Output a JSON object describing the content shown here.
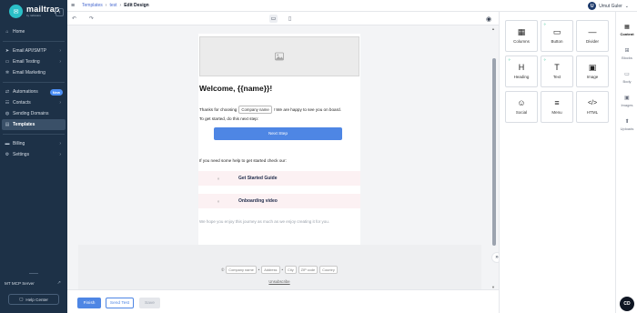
{
  "sidebar": {
    "logo": {
      "name": "mailtrap",
      "sub": "by railsware"
    },
    "items": [
      {
        "label": "Home",
        "icon": "home-icon"
      },
      {
        "label": "Email API/SMTP",
        "icon": "send-icon"
      },
      {
        "label": "Email Testing",
        "icon": "inbox-icon"
      },
      {
        "label": "Email Marketing",
        "icon": "megaphone-icon"
      },
      {
        "label": "Automations",
        "icon": "automation-icon",
        "badge": "New"
      },
      {
        "label": "Contacts",
        "icon": "contacts-icon"
      },
      {
        "label": "Sending Domains",
        "icon": "globe-icon"
      },
      {
        "label": "Templates",
        "icon": "template-icon"
      },
      {
        "label": "Billing",
        "icon": "billing-icon"
      },
      {
        "label": "Settings",
        "icon": "gear-icon"
      }
    ],
    "mcp_label": "MT MCP Server",
    "help_label": "Help Center"
  },
  "header": {
    "breadcrumb": [
      "Templates",
      "test",
      "Edit Design"
    ],
    "user": {
      "initial": "U",
      "name": "Umut Guler"
    }
  },
  "email": {
    "heading": "Welcome, {{name}}!",
    "thanks_before": "Thanks for choosing",
    "company_tag": "Company name",
    "thanks_after": "! We are happy to see you on board.",
    "get_started": "To get started, do this next step:",
    "next_step_button": "Next Step",
    "help_line": "If you need some help to get started check our:",
    "guides": [
      {
        "placeholder": "×",
        "title": "Get Started Guide"
      },
      {
        "placeholder": "×",
        "title": "Onboarding video"
      }
    ],
    "closing": "We hope you enjoy this journey as much as we enjoy creating it for you.",
    "footer": {
      "copyright": "©",
      "company": "Company name",
      "address": "Address",
      "city": "City",
      "zip": "ZIP code",
      "country": "Country",
      "separator": "•",
      "unsubscribe": "Unsubscribe"
    }
  },
  "blocks": [
    {
      "label": "Columns",
      "icon": "columns-icon",
      "glyph": "▦",
      "ai": false
    },
    {
      "label": "Button",
      "icon": "button-icon",
      "glyph": "▭",
      "ai": true
    },
    {
      "label": "Divider",
      "icon": "divider-icon",
      "glyph": "—",
      "ai": false
    },
    {
      "label": "Heading",
      "icon": "heading-icon",
      "glyph": "H",
      "ai": true
    },
    {
      "label": "Text",
      "icon": "text-icon",
      "glyph": "T",
      "ai": true
    },
    {
      "label": "Image",
      "icon": "image-icon",
      "glyph": "▣",
      "ai": false
    },
    {
      "label": "Social",
      "icon": "social-icon",
      "glyph": "☺",
      "ai": false
    },
    {
      "label": "Menu",
      "icon": "menu-icon",
      "glyph": "≡",
      "ai": false
    },
    {
      "label": "HTML",
      "icon": "html-icon",
      "glyph": "</>",
      "ai": false
    }
  ],
  "right_tabs": [
    {
      "label": "Content",
      "icon": "content-icon",
      "glyph": "▦"
    },
    {
      "label": "Blocks",
      "icon": "blocks-icon",
      "glyph": "⊞"
    },
    {
      "label": "Body",
      "icon": "body-icon",
      "glyph": "▭"
    },
    {
      "label": "Images",
      "icon": "images-icon",
      "glyph": "▣"
    },
    {
      "label": "Uploads",
      "icon": "upload-icon",
      "glyph": "⬆"
    }
  ],
  "actions": {
    "finish": "Finish",
    "send_test": "Send Test",
    "save": "Save"
  },
  "chat": {
    "initials": "CD"
  },
  "colors": {
    "sidebar": "#1d3147",
    "accent": "#4e86e4",
    "ai_badge": "#1fb98a"
  }
}
